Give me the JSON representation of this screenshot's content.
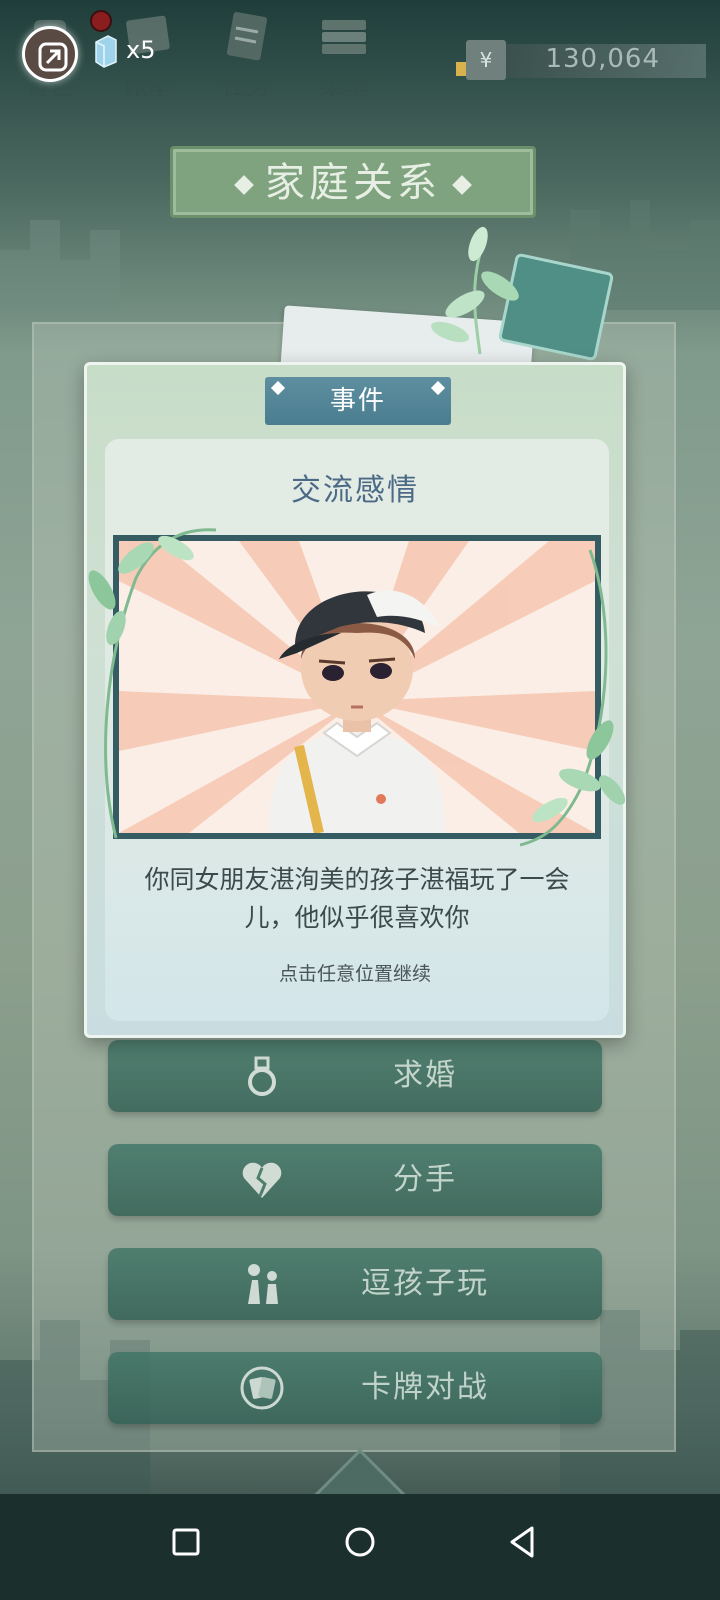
{
  "topbar": {
    "items": [
      {
        "label": "背包",
        "icon": "backpack-icon"
      },
      {
        "label": "账单",
        "icon": "bill-icon"
      },
      {
        "label": "任务",
        "icon": "task-icon"
      },
      {
        "label": "菜单",
        "icon": "menu-icon"
      }
    ],
    "gem_count": "x5",
    "currency_symbol": "¥",
    "money": "130,064"
  },
  "page": {
    "title": "家庭关系"
  },
  "dialog": {
    "tag": "事件",
    "title": "交流感情",
    "message": "你同女朋友湛洵美的孩子湛福玩了一会儿，他似乎很喜欢你",
    "hint": "点击任意位置继续"
  },
  "actions": [
    {
      "label": "求婚",
      "icon": "ring-icon"
    },
    {
      "label": "分手",
      "icon": "broken-heart-icon"
    },
    {
      "label": "逗孩子玩",
      "icon": "play-with-child-icon"
    },
    {
      "label": "卡牌对战",
      "icon": "card-battle-icon"
    }
  ],
  "colors": {
    "accent": "#4a7d8f",
    "button": "#2f5e52",
    "title_text": "#4c6a86"
  }
}
